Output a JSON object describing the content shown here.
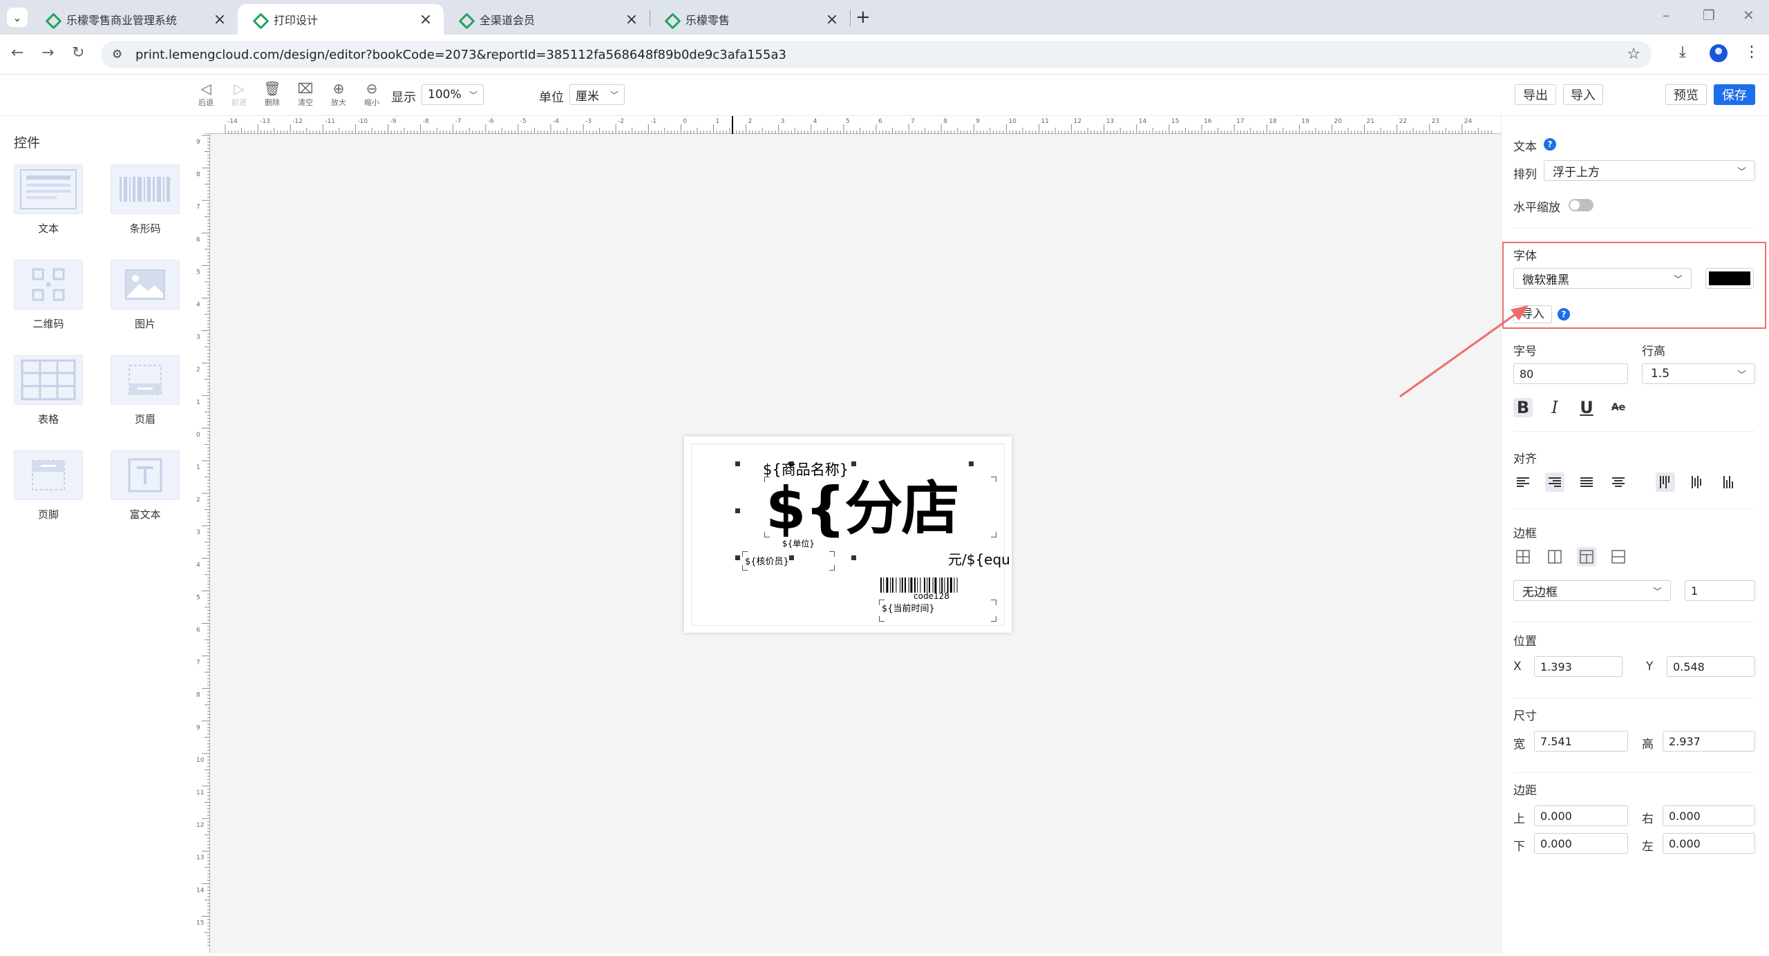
{
  "browser": {
    "tabs": [
      {
        "title": "乐檬零售商业管理系统"
      },
      {
        "title": "打印设计"
      },
      {
        "title": "全渠道会员"
      },
      {
        "title": "乐檬零售"
      }
    ],
    "url": "print.lemengcloud.com/design/editor?bookCode=2073&reportId=385112fa568648f89b0de9c3afa155a3"
  },
  "toolbar": {
    "undo": "后退",
    "redo": "前进",
    "delete": "删除",
    "clear": "清空",
    "zoom_in": "放大",
    "zoom_out": "缩小",
    "display_label": "显示",
    "display_value": "100%",
    "unit_label": "单位",
    "unit_value": "厘米",
    "export": "导出",
    "import": "导入",
    "preview": "预览",
    "save": "保存"
  },
  "left_panel": {
    "title": "控件",
    "widgets": [
      {
        "label": "文本",
        "icon": "text-icon"
      },
      {
        "label": "条形码",
        "icon": "barcode-icon"
      },
      {
        "label": "二维码",
        "icon": "qrcode-icon"
      },
      {
        "label": "图片",
        "icon": "image-icon"
      },
      {
        "label": "表格",
        "icon": "table-icon"
      },
      {
        "label": "页眉",
        "icon": "header-icon"
      },
      {
        "label": "页脚",
        "icon": "footer-icon"
      },
      {
        "label": "富文本",
        "icon": "rich-text-icon"
      }
    ]
  },
  "ruler": {
    "top": [
      "-14",
      "-13",
      "-12",
      "-11",
      "-10",
      "-9",
      "-8",
      "-7",
      "-6",
      "-5",
      "-4",
      "-3",
      "-2",
      "-1",
      "0",
      "1",
      "2",
      "3",
      "4",
      "5",
      "6",
      "7",
      "8",
      "9",
      "10",
      "11",
      "12",
      "13",
      "14",
      "15",
      "16",
      "17",
      "18",
      "19",
      "20",
      "21",
      "22",
      "23",
      "24"
    ],
    "left": [
      "9",
      "8",
      "7",
      "6",
      "5",
      "4",
      "3",
      "2",
      "1",
      "0",
      "1",
      "2",
      "3",
      "4",
      "5",
      "6",
      "7",
      "8",
      "9",
      "10",
      "11",
      "12",
      "13",
      "14",
      "15"
    ]
  },
  "label_preview": {
    "product_name": "${商品名称}",
    "store": "${分店",
    "unit": "${单位}",
    "price_checker": "${核价员}",
    "currency": "元/${equ",
    "barcode_caption": "code128",
    "current_time": "${当前时间}"
  },
  "right_panel": {
    "section_title": "文本",
    "arrange_label": "排列",
    "arrange_value": "浮于上方",
    "h_scale_label": "水平缩放",
    "font_label": "字体",
    "font_value": "微软雅黑",
    "font_color": "#000000",
    "import_font": "导入",
    "size_label": "字号",
    "size_value": "80",
    "line_height_label": "行高",
    "line_height_value": "1.5",
    "align_label": "对齐",
    "border_label": "边框",
    "border_style": "无边框",
    "border_width": "1",
    "position_label": "位置",
    "x_label": "X",
    "x_value": "1.393",
    "y_label": "Y",
    "y_value": "0.548",
    "size_section_label": "尺寸",
    "width_label": "宽",
    "width_value": "7.541",
    "height_label": "高",
    "height_value": "2.937",
    "margin_label": "边距",
    "top_label": "上",
    "top_value": "0.000",
    "right_label": "右",
    "right_value": "0.000",
    "bottom_label": "下",
    "bottom_value": "0.000",
    "left_label": "左",
    "left_value": "0.000"
  },
  "colors": {
    "accent": "#1c6fe8",
    "highlight": "#ef6b6b"
  }
}
